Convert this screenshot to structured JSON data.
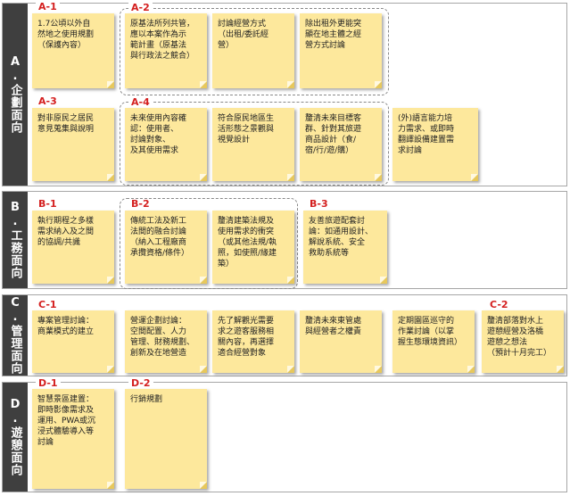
{
  "bands": [
    {
      "label": "A.企劃面向"
    },
    {
      "label": "B.工務面向"
    },
    {
      "label": "C.管理面向"
    },
    {
      "label": "D.遊憩面向"
    }
  ],
  "tags": {
    "a1": "A-1",
    "a2": "A-2",
    "a3": "A-3",
    "a4": "A-4",
    "b1": "B-1",
    "b2": "B-2",
    "b3": "B-3",
    "c1": "C-1",
    "c2": "C-2",
    "d1": "D-1",
    "d2": "D-2"
  },
  "notes": {
    "a1": "1.7公頃以外自\n然地之使用規劃\n（保護內容）",
    "a2_1": "原基法所列共管，\n應以本案作為示\n範計畫（原基法\n與行政法之競合）",
    "a2_2": "討論經營方式\n（出租/委託經\n營）",
    "a2_3": "除出租外更能突\n顯在地主體之經\n營方式討論",
    "a3": "對非原民之居民\n意見蒐集與說明",
    "a4_1": "未來使用內容確\n認：使用者、\n討論對象、\n及其使用需求",
    "a4_2": "符合原民地區生\n活形態之景觀與\n視覺設計",
    "a4_3": "釐清未來目標客\n群、針對其旅遊\n商品設計（食/\n宿/行/遊/購）",
    "a4_4": "(外)語言能力培\n力需求、或即時\n翻譯設備建置需\n求討論",
    "b1": "執行期程之多樣\n需求納入及之間\n的協調/共識",
    "b2_1": "傳統工法及新工\n法間的融合討論\n（納入工程廠商\n承攬資格/條件）",
    "b2_2": "釐清建築法規及\n使用需求的衝突\n（或其他法規/執\n照，如使照/緣建\n築）",
    "b3": "友善旅遊配套討\n論：如通用設計、\n解說系統、安全\n救助系統等",
    "c1_1": "專案管理討論：\n商業模式的建立",
    "c1_2": "營運企劃討論：\n空間配置、人力\n管理、財務規劃、\n創新及在地營造",
    "c1_3": "先了解觀光需要\n求之遊客服務相\n關內容，再選擇\n適合經營對象",
    "c1_4": "釐清未來東管處\n與經營者之權責",
    "c1_5": "定期園區巡守的\n作業討論（以掌\n握生態環境資訊）",
    "c2": "釐清部落對水上\n遊憩經營及洛橋\n遊憩之想法\n（預計十月完工）",
    "d1": "智慧景區建置：\n即時影像需求及\n運用、PWA或沉\n浸式體驗導入等\n討論",
    "d2": "行銷規劃"
  }
}
